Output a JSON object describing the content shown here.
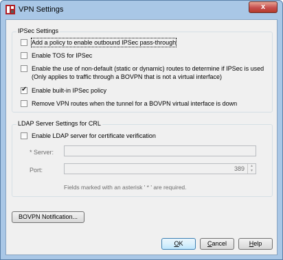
{
  "window": {
    "title": "VPN Settings",
    "close_glyph": "x"
  },
  "ipsec": {
    "title": "IPSec Settings",
    "options": [
      {
        "label": "Add a policy to enable outbound IPSec pass-through",
        "checked": false
      },
      {
        "label": "Enable TOS for IPSec",
        "checked": false
      },
      {
        "label": "Enable the use of non-default (static or dynamic) routes to determine if IPSec is used",
        "label2": "(Only applies to traffic through a BOVPN that is not a virtual interface)",
        "checked": false
      },
      {
        "label": "Enable built-in IPSec policy",
        "checked": true
      },
      {
        "label": "Remove VPN routes when the tunnel for a BOVPN virtual interface is down",
        "checked": false
      }
    ]
  },
  "ldap": {
    "title": "LDAP Server Settings for CRL",
    "enable_label": "Enable LDAP server for certificate verification",
    "enabled": false,
    "server_label": "* Server:",
    "server_value": "",
    "port_label": "Port:",
    "port_value": "389",
    "note": "Fields marked with an asterisk ' * ' are required."
  },
  "buttons": {
    "bovpn": "BOVPN Notification...",
    "ok_u": "O",
    "ok_rest": "K",
    "cancel_u": "C",
    "cancel_rest": "ancel",
    "help_u": "H",
    "help_rest": "elp"
  }
}
